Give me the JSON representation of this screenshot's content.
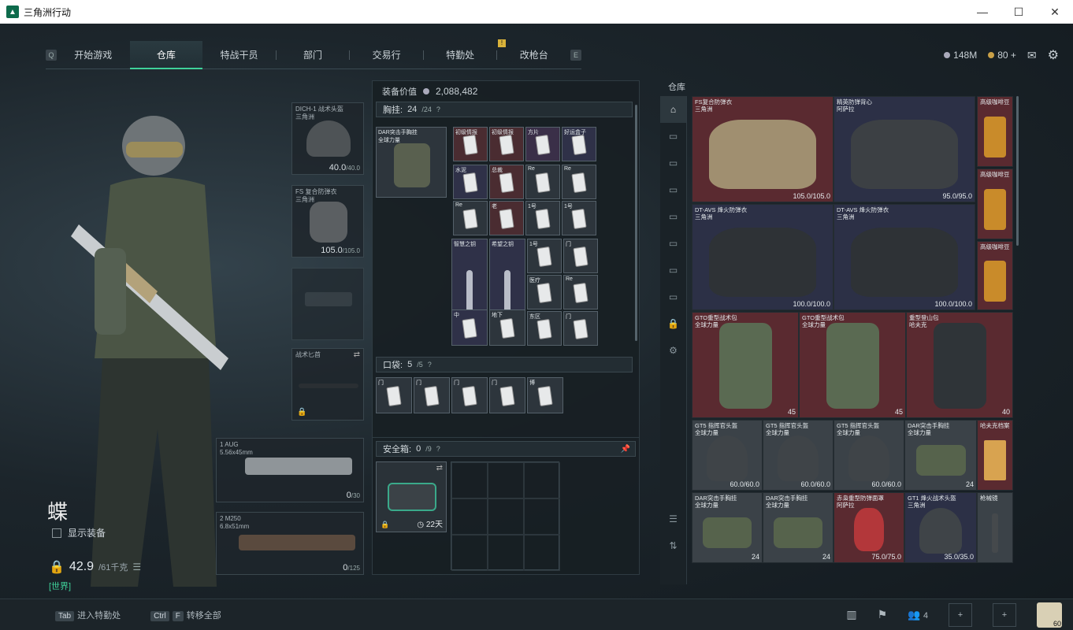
{
  "window": {
    "title": "三角洲行动",
    "minimize": "—",
    "maximize": "☐",
    "close": "✕"
  },
  "nav": {
    "key_left": "Q",
    "key_right": "E",
    "tabs": [
      "开始游戏",
      "仓库",
      "特战干员",
      "部门",
      "交易行",
      "特勤处",
      "改枪台"
    ],
    "active": "仓库",
    "badge": "!"
  },
  "currency": {
    "silver": "148M",
    "gold": "80",
    "plus": "+",
    "mail_icon": "mail-icon",
    "settings_icon": "gear-icon"
  },
  "character": {
    "name": "蝶",
    "show_gear": "显示装备",
    "weight": "42.9",
    "weight_max": "/61千克",
    "channel": "[世界]"
  },
  "loadout": {
    "helmet": {
      "label": "DICH-1 战术头盔",
      "maker": "三角洲",
      "durability": "40.0",
      "max": "/40.0"
    },
    "armor": {
      "label": "FS 复合防弹衣",
      "maker": "三角洲",
      "durability": "105.0",
      "max": "/105.0"
    },
    "melee": {
      "label": "战术匕首"
    },
    "primary": {
      "slot": "1",
      "name": "AUG",
      "caliber": "5.56x45mm",
      "ammo": "0",
      "ammo_max": "/30"
    },
    "secondary": {
      "slot": "2",
      "name": "M250",
      "caliber": "6.8x51mm",
      "ammo": "0",
      "ammo_max": "/125"
    }
  },
  "equipment": {
    "value_label": "装备价值",
    "value": "2,088,482",
    "rig_label": "胸挂:",
    "rig_count": "24",
    "rig_max": "/24",
    "rig_item": "DAR突击手胸挂",
    "rig_maker": "全球力量",
    "pockets_label": "口袋:",
    "pockets_count": "5",
    "pockets_max": "/5",
    "safebox_label": "安全箱:",
    "safebox_count": "0",
    "safebox_max": "/9",
    "safebox_timer": "22天",
    "rig_cells": [
      "初级情报",
      "初级情报",
      "方片",
      "好运盒子",
      "水泥",
      "总裁",
      "Re",
      "Re",
      "Re",
      "老",
      "1号",
      "1号",
      "智慧之钥",
      "希望之钥",
      "1号",
      "门",
      "医疗",
      "Re",
      "中",
      "地下",
      "东区",
      "门"
    ],
    "pocket_cells": [
      "门",
      "门",
      "门",
      "门",
      "博"
    ]
  },
  "stash": {
    "title": "仓库",
    "items": [
      {
        "name": "FS复合防弹衣",
        "maker": "三角洲",
        "value": "105.0/105.0"
      },
      {
        "name": "精英防弹背心",
        "maker": "阿萨拉",
        "value": "95.0/95.0"
      },
      {
        "name": "高级咖啡豆",
        "maker": "",
        "value": ""
      },
      {
        "name": "高级咖啡豆",
        "maker": "",
        "value": ""
      },
      {
        "name": "DT-AVS 烽火防弹衣",
        "maker": "三角洲",
        "value": "100.0/100.0"
      },
      {
        "name": "DT-AVS 烽火防弹衣",
        "maker": "三角洲",
        "value": "100.0/100.0"
      },
      {
        "name": "高级咖啡豆",
        "maker": "",
        "value": ""
      },
      {
        "name": "GTO重型战术包",
        "maker": "全球力量",
        "value": "45"
      },
      {
        "name": "GTO重型战术包",
        "maker": "全球力量",
        "value": "45"
      },
      {
        "name": "重型登山包",
        "maker": "哈夫克",
        "value": "40"
      },
      {
        "name": "GT5 指挥官头盔",
        "maker": "全球力量",
        "value": "60.0/60.0"
      },
      {
        "name": "GT5 指挥官头盔",
        "maker": "全球力量",
        "value": "60.0/60.0"
      },
      {
        "name": "GT5 指挥官头盔",
        "maker": "全球力量",
        "value": "60.0/60.0"
      },
      {
        "name": "DAR突击手胸挂",
        "maker": "全球力量",
        "value": "24"
      },
      {
        "name": "哈夫克档案",
        "maker": "",
        "value": ""
      },
      {
        "name": "DAR突击手胸挂",
        "maker": "全球力量",
        "value": "24"
      },
      {
        "name": "DAR突击手胸挂",
        "maker": "全球力量",
        "value": "24"
      },
      {
        "name": "赤枭重型防弹面罩",
        "maker": "阿萨拉",
        "value": "75.0/75.0"
      },
      {
        "name": "GT1 烽火战术头盔",
        "maker": "三角洲",
        "value": "35.0/35.0"
      },
      {
        "name": "枪械镜",
        "maker": "",
        "value": ""
      }
    ]
  },
  "bottom": {
    "tab_key": "Tab",
    "tab_label": "进入特勤处",
    "ctrl_key": "Ctrl",
    "f_key": "F",
    "transfer_label": "转移全部",
    "squad_count": "4",
    "avatar_level": "60"
  },
  "colors": {
    "accent": "#3fd29a",
    "red_rarity": "#5a2a30",
    "blue_rarity": "#2c3046",
    "gold": "#c9a047"
  }
}
